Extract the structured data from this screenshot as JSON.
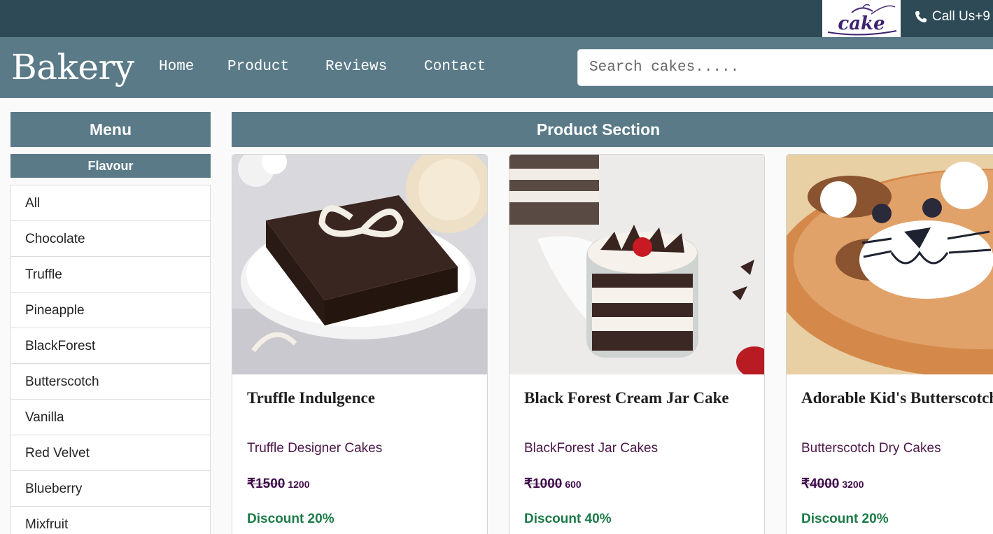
{
  "topbar": {
    "logo_text": "cake",
    "call_label": "Call Us+9"
  },
  "navbar": {
    "brand": "Bakery",
    "links": [
      "Home",
      "Product",
      "Reviews",
      "Contact"
    ],
    "search_placeholder": "Search cakes....."
  },
  "sidebar": {
    "menu_title": "Menu",
    "flavour_title": "Flavour",
    "flavours": [
      "All",
      "Chocolate",
      "Truffle",
      "Pineapple",
      "BlackForest",
      "Butterscotch",
      "Vanilla",
      "Red Velvet",
      "Blueberry",
      "Mixfruit"
    ]
  },
  "products": {
    "section_title": "Product Section",
    "items": [
      {
        "title": "Truffle Indulgence",
        "subtitle": "Truffle Designer Cakes",
        "old_price": "₹1500",
        "new_price": "1200",
        "discount": "Discount 20%"
      },
      {
        "title": "Black Forest Cream Jar Cake",
        "subtitle": "BlackForest Jar Cakes",
        "old_price": "₹1000",
        "new_price": "600",
        "discount": "Discount 40%"
      },
      {
        "title": "Adorable Kid's Butterscotch Cake",
        "subtitle": "Butterscotch Dry Cakes",
        "old_price": "₹4000",
        "new_price": "3200",
        "discount": "Discount 20%"
      }
    ]
  },
  "colors": {
    "topbar": "#2d4a56",
    "navbar": "#5a7a88",
    "subtitle": "#4b1547",
    "price": "#3f0d4a",
    "discount": "#1c7a47"
  }
}
